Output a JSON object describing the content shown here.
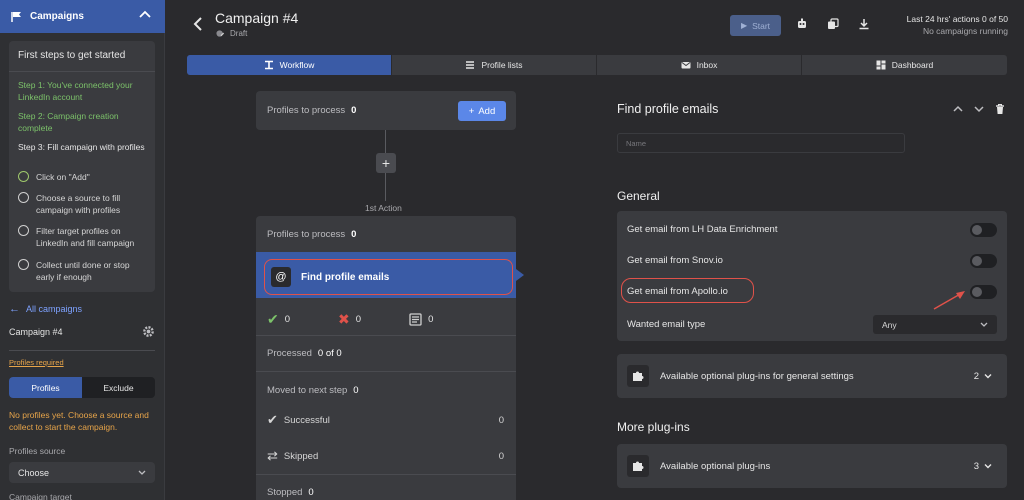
{
  "sidebar": {
    "header": "Campaigns",
    "steps_title": "First steps to get started",
    "steps": [
      {
        "text": "Step 1: You've connected your LinkedIn account",
        "state": "done"
      },
      {
        "text": "Step 2: Campaign creation complete",
        "state": "done"
      },
      {
        "text": "Step 3: Fill campaign with profiles",
        "state": "current"
      }
    ],
    "checklist": [
      "Click on \"Add\"",
      "Choose a source to fill campaign with profiles",
      "Filter target profiles on LinkedIn and fill campaign",
      "Collect until done or stop early if enough"
    ],
    "all_campaigns": "All campaigns",
    "campaign_name": "Campaign #4",
    "profiles_required": "Profiles required",
    "seg_profiles": "Profiles",
    "seg_exclude": "Exclude",
    "warning": "No profiles yet. Choose a source and collect to start the campaign.",
    "profiles_source_label": "Profiles source",
    "profiles_source_value": "Choose",
    "campaign_target_label": "Campaign target"
  },
  "topbar": {
    "title": "Campaign #4",
    "status": "Draft",
    "start": "Start",
    "actions_line1": "Last 24 hrs' actions 0 of 50",
    "actions_line2": "No campaigns running"
  },
  "tabs": [
    "Workflow",
    "Profile lists",
    "Inbox",
    "Dashboard"
  ],
  "workflow": {
    "ptp_label": "Profiles to process",
    "ptp_top_count": "0",
    "add": "Add",
    "first_action": "1st Action",
    "ptp_action_count": "0",
    "action_label": "Find profile emails",
    "stat_success": "0",
    "stat_fail": "0",
    "stat_other": "0",
    "processed_label": "Processed",
    "processed_value": "0 of 0",
    "moved_label": "Moved to next step",
    "moved_value": "0",
    "successful_label": "Successful",
    "successful_value": "0",
    "skipped_label": "Skipped",
    "skipped_value": "0",
    "stopped_label": "Stopped",
    "stopped_value": "0"
  },
  "panel": {
    "title": "Find profile emails",
    "name_placeholder": "Name",
    "general": "General",
    "opt1": "Get email from LH Data Enrichment",
    "opt2": "Get email from Snov.io",
    "opt3": "Get email from Apollo.io",
    "opt4": "Wanted email type",
    "email_type_value": "Any",
    "plugins_general_label": "Available optional plug-ins for general settings",
    "plugins_general_count": "2",
    "more_plugins": "More plug-ins",
    "plugins_label": "Available optional plug-ins",
    "plugins_count": "3"
  },
  "colors": {
    "accent": "#3a5ba6",
    "add_button": "#5b87e8",
    "highlight": "#e0524a",
    "success": "#7cc26a",
    "warning": "#e8a54a"
  }
}
